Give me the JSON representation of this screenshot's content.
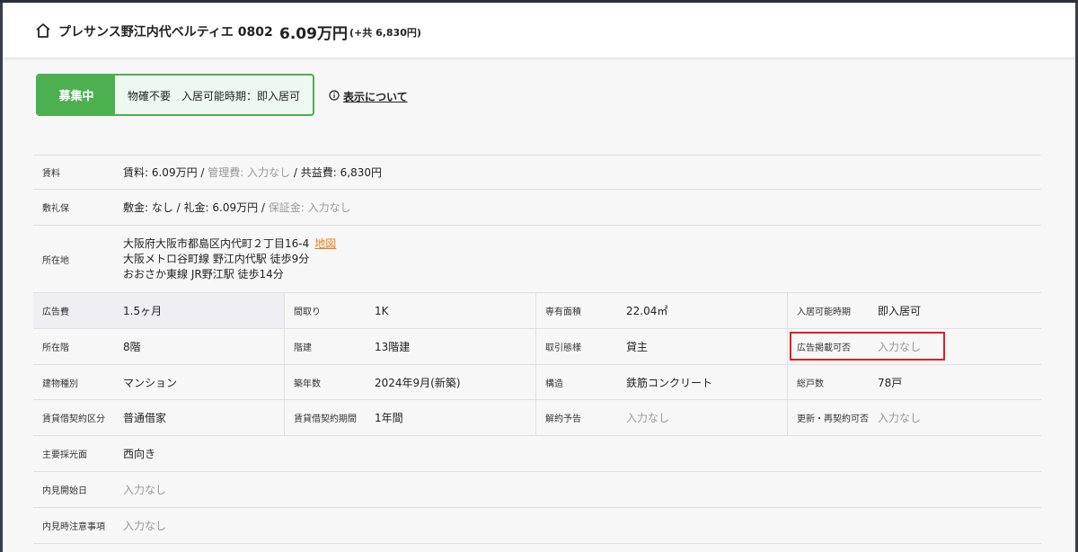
{
  "header": {
    "title": "プレサンス野江内代ベルティエ 0802",
    "price": "6.09万円",
    "common_fee": "(+共 6,830円)"
  },
  "status": {
    "badge": "募集中",
    "text": "物確不要　入居可能時期：即入居可",
    "info_link": "表示について"
  },
  "details": {
    "rent": {
      "label": "賃料",
      "rent_text": "賃料: 6.09万円",
      "sep1": " / ",
      "mgmt_text": "管理費: 入力なし",
      "sep2": " / ",
      "common_text": "共益費: 6,830円"
    },
    "deposit": {
      "label": "敷礼保",
      "shiki": "敷金: なし",
      "sep1": " / ",
      "rei": "礼金: 6.09万円",
      "sep2": " / ",
      "hosho": "保証金: 入力なし"
    },
    "address": {
      "label": "所在地",
      "line1": "大阪府大阪市都島区内代町２丁目16-4",
      "map": "地図",
      "line2": "大阪メトロ谷町線 野江内代駅 徒歩9分",
      "line3": "おおさか東線 JR野江駅 徒歩14分"
    },
    "grid": [
      [
        {
          "label": "広告費",
          "value": "1.5ヶ月"
        },
        {
          "label": "間取り",
          "value": "1K"
        },
        {
          "label": "専有面積",
          "value": "22.04㎡"
        },
        {
          "label": "入居可能時期",
          "value": "即入居可"
        }
      ],
      [
        {
          "label": "所在階",
          "value": "8階"
        },
        {
          "label": "階建",
          "value": "13階建"
        },
        {
          "label": "取引態様",
          "value": "貸主"
        },
        {
          "label": "広告掲載可否",
          "value": "入力なし"
        }
      ],
      [
        {
          "label": "建物種別",
          "value": "マンション"
        },
        {
          "label": "築年数",
          "value": "2024年9月(新築)"
        },
        {
          "label": "構造",
          "value": "鉄筋コンクリート"
        },
        {
          "label": "総戸数",
          "value": "78戸"
        }
      ],
      [
        {
          "label": "賃貸借契約区分",
          "value": "普通借家"
        },
        {
          "label": "賃貸借契約期間",
          "value": "1年間"
        },
        {
          "label": "解約予告",
          "value": "入力なし"
        },
        {
          "label": "更新・再契約可否",
          "value": "入力なし"
        }
      ]
    ],
    "lighting": {
      "label": "主要採光面",
      "value": "西向き"
    },
    "viewing_start": {
      "label": "内見開始日",
      "value": "入力なし"
    },
    "viewing_notes": {
      "label": "内見時注意事項",
      "value": "入力なし"
    }
  }
}
